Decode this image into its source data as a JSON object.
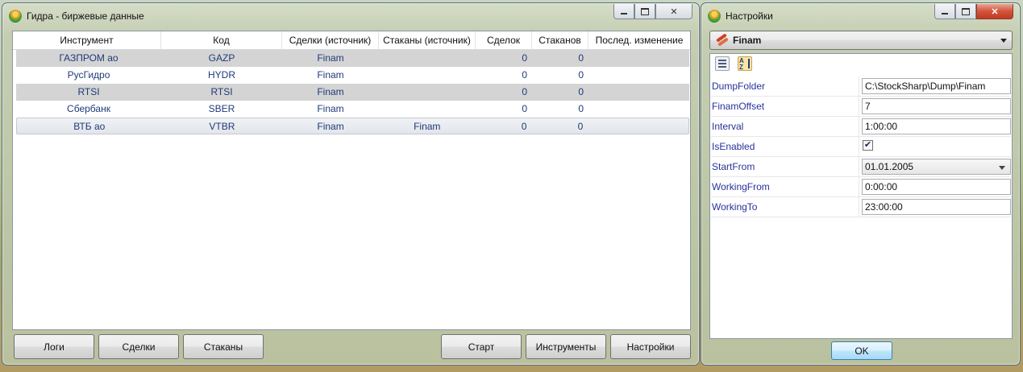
{
  "main_window": {
    "title": "Гидра - биржевые данные",
    "columns": [
      "Инструмент",
      "Код",
      "Сделки (источник)",
      "Стаканы (источник)",
      "Сделок",
      "Стаканов",
      "Послед. изменение"
    ],
    "rows": [
      {
        "instrument": "ГАЗПРОМ ао",
        "code": "GAZP",
        "trades_source": "Finam",
        "depth_source": "",
        "trades": "0",
        "depths": "0",
        "last_change": ""
      },
      {
        "instrument": "РусГидро",
        "code": "HYDR",
        "trades_source": "Finam",
        "depth_source": "",
        "trades": "0",
        "depths": "0",
        "last_change": ""
      },
      {
        "instrument": "RTSI",
        "code": "RTSI",
        "trades_source": "Finam",
        "depth_source": "",
        "trades": "0",
        "depths": "0",
        "last_change": ""
      },
      {
        "instrument": "Сбербанк",
        "code": "SBER",
        "trades_source": "Finam",
        "depth_source": "",
        "trades": "0",
        "depths": "0",
        "last_change": ""
      },
      {
        "instrument": "ВТБ ао",
        "code": "VTBR",
        "trades_source": "Finam",
        "depth_source": "Finam",
        "trades": "0",
        "depths": "0",
        "last_change": ""
      }
    ],
    "buttons": {
      "logs": "Логи",
      "trades": "Сделки",
      "depths": "Стаканы",
      "start": "Старт",
      "instruments": "Инструменты",
      "settings": "Настройки"
    }
  },
  "settings_window": {
    "title": "Настройки",
    "source": "Finam",
    "properties": [
      {
        "name": "DumpFolder",
        "value": "C:\\StockSharp\\Dump\\Finam"
      },
      {
        "name": "FinamOffset",
        "value": "7"
      },
      {
        "name": "Interval",
        "value": "1:00:00"
      },
      {
        "name": "IsEnabled",
        "value": ""
      },
      {
        "name": "StartFrom",
        "value": "01.01.2005"
      },
      {
        "name": "WorkingFrom",
        "value": "0:00:00"
      },
      {
        "name": "WorkingTo",
        "value": "23:00:00"
      }
    ],
    "is_enabled_checked": true,
    "ok_label": "OK"
  }
}
